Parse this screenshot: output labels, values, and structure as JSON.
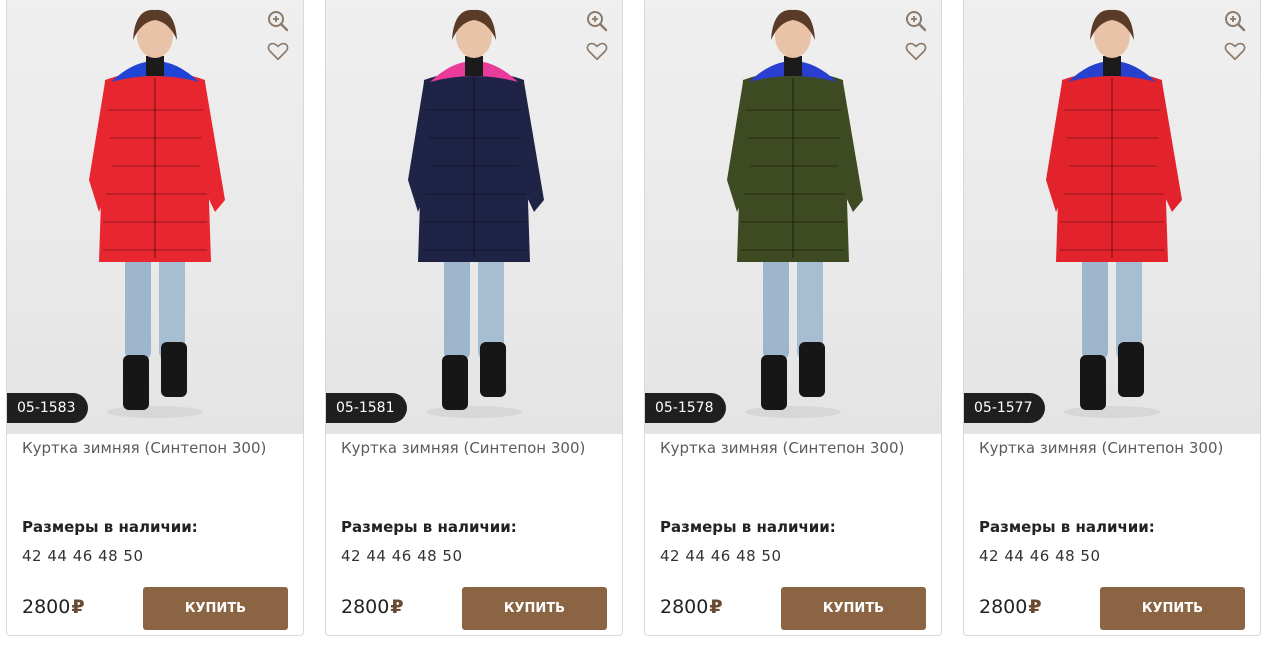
{
  "products": [
    {
      "sku": "05-1583",
      "title": "Куртка зимняя (Синтепон 300)",
      "sizes_label": "Размеры в наличии:",
      "sizes": "42 44 46 48 50",
      "price": "2800",
      "currency": "₽",
      "buy_label": "КУПИТЬ",
      "jacket_color": "#e8262f",
      "hood_color": "#1f44d6"
    },
    {
      "sku": "05-1581",
      "title": "Куртка зимняя (Синтепон 300)",
      "sizes_label": "Размеры в наличии:",
      "sizes": "42 44 46 48 50",
      "price": "2800",
      "currency": "₽",
      "buy_label": "КУПИТЬ",
      "jacket_color": "#1f2446",
      "hood_color": "#e83b9a"
    },
    {
      "sku": "05-1578",
      "title": "Куртка зимняя (Синтепон 300)",
      "sizes_label": "Размеры в наличии:",
      "sizes": "42 44 46 48 50",
      "price": "2800",
      "currency": "₽",
      "buy_label": "КУПИТЬ",
      "jacket_color": "#3e4a22",
      "hood_color": "#2a3fd0"
    },
    {
      "sku": "05-1577",
      "title": "Куртка зимняя (Синтепон 300)",
      "sizes_label": "Размеры в наличии:",
      "sizes": "42 44 46 48 50",
      "price": "2800",
      "currency": "₽",
      "buy_label": "КУПИТЬ",
      "jacket_color": "#e3232c",
      "hood_color": "#2640d0"
    }
  ],
  "icons": {
    "zoom": "zoom-in-icon",
    "favorite": "heart-icon"
  },
  "colors": {
    "button": "#8b6444",
    "currency": "#6b4a33",
    "sku_badge": "#1f1f1f"
  }
}
